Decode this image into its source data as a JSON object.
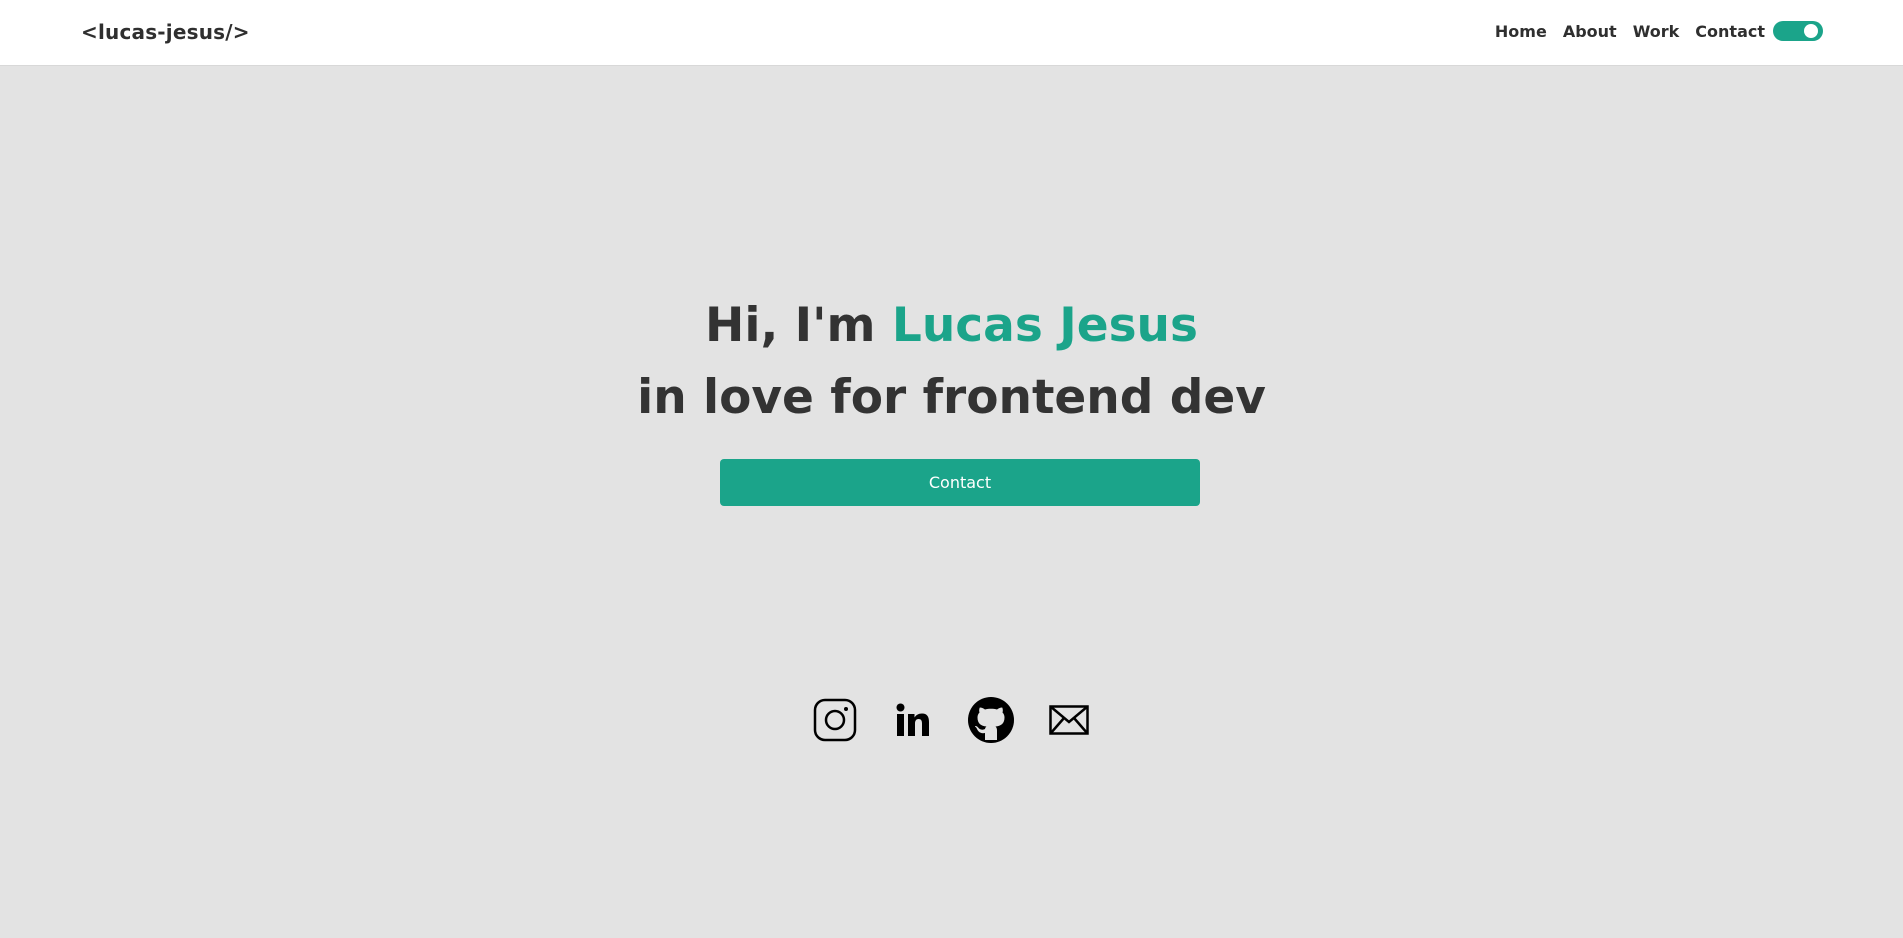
{
  "header": {
    "logo": "<lucas-jesus/>",
    "nav": [
      "Home",
      "About",
      "Work",
      "Contact"
    ],
    "theme_toggle": {
      "state": "on"
    }
  },
  "hero": {
    "greeting_prefix": "Hi, I'm ",
    "name": "Lucas Jesus",
    "tagline": "in love for frontend dev",
    "cta_label": "Contact"
  },
  "socials": [
    {
      "icon": "instagram-icon"
    },
    {
      "icon": "linkedin-icon"
    },
    {
      "icon": "github-icon"
    },
    {
      "icon": "mail-icon"
    }
  ],
  "colors": {
    "accent": "#1ba48a",
    "background": "#e3e3e3",
    "header_bg": "#ffffff",
    "text": "#333333"
  }
}
